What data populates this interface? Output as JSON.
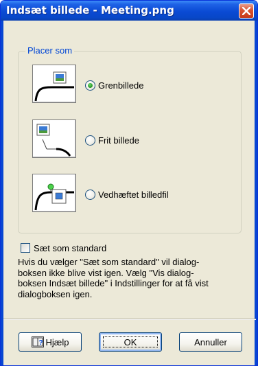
{
  "window": {
    "title": "Indsæt billede - Meeting.png"
  },
  "group": {
    "legend": "Placer som",
    "options": [
      {
        "label": "Grenbillede",
        "checked": true,
        "icon": "branch-image-icon"
      },
      {
        "label": "Frit billede",
        "checked": false,
        "icon": "free-image-icon"
      },
      {
        "label": "Vedhæftet billedfil",
        "checked": false,
        "icon": "attached-image-file-icon"
      }
    ]
  },
  "default_checkbox": {
    "label": "Sæt som standard",
    "checked": false
  },
  "info_lines": [
    "Hvis du vælger \"Sæt som standard\" vil dialog-",
    "boksen ikke blive vist igen. Vælg \"Vis dialog-",
    "boksen Indsæt billede\" i Indstillinger for at få vist",
    "dialogboksen igen."
  ],
  "buttons": {
    "help": "Hjælp",
    "ok": "OK",
    "cancel": "Annuller"
  },
  "colors": {
    "titlebar": "#0a4ad4",
    "dialog_bg": "#ece9d8",
    "legend_text": "#0046d5",
    "close_button": "#d8512f"
  }
}
